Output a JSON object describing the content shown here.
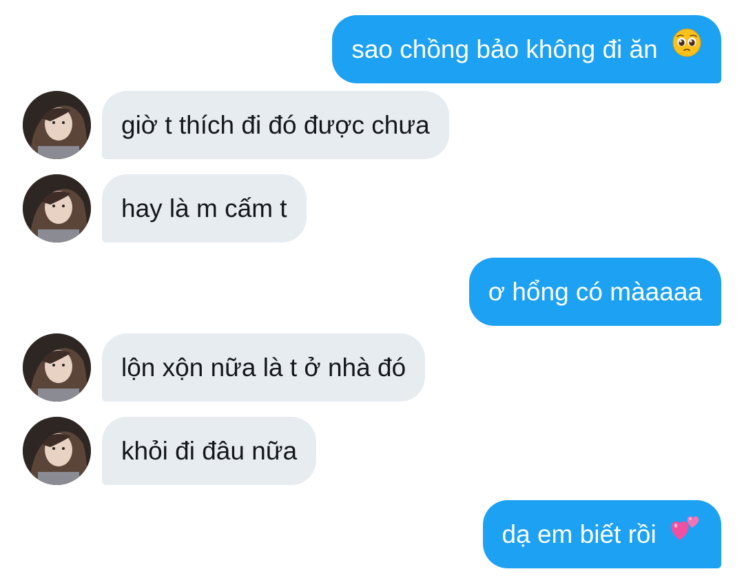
{
  "conversation": {
    "messages": [
      {
        "side": "sent",
        "text": "sao chồng bảo không đi ăn",
        "emoji": "pleading-face-icon"
      },
      {
        "side": "received",
        "text": "giờ t thích đi đó được chưa"
      },
      {
        "side": "received",
        "text": "hay là m cấm t"
      },
      {
        "side": "sent",
        "text": "ơ hổng có màaaaa"
      },
      {
        "side": "received",
        "text": "lộn xộn nữa là t ở nhà đó"
      },
      {
        "side": "received",
        "text": "khỏi đi đâu nữa"
      },
      {
        "side": "sent",
        "text": "dạ em biết rồi",
        "emoji": "two-hearts-icon"
      }
    ]
  },
  "colors": {
    "sent_bubble": "#1da1f2",
    "received_bubble": "#e6ecf0",
    "sent_text": "#ffffff",
    "received_text": "#14171a"
  }
}
